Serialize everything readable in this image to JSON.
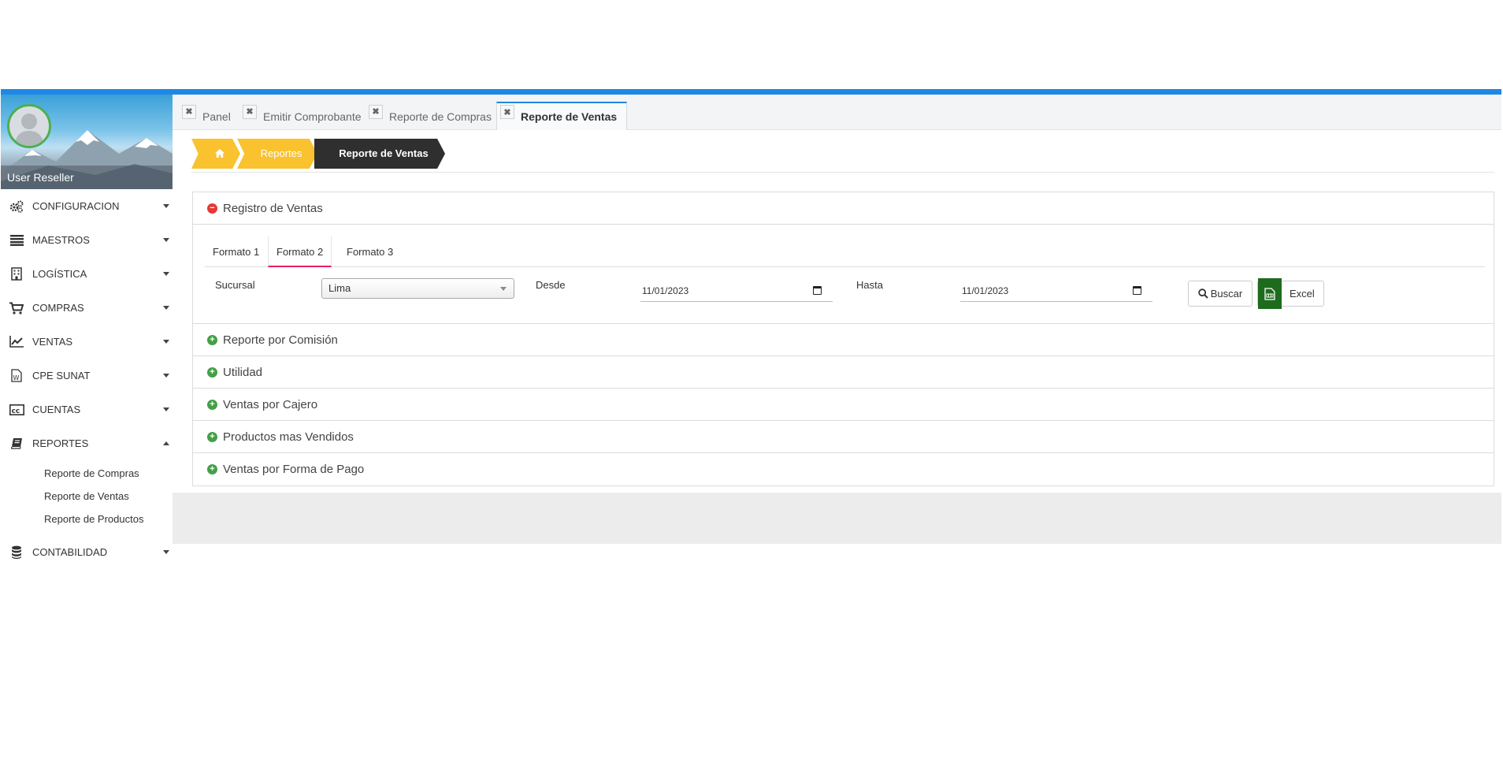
{
  "sidebar": {
    "username": "User Reseller",
    "menu": [
      {
        "label": "CONFIGURACION",
        "icon": "gears-icon"
      },
      {
        "label": "MAESTROS",
        "icon": "bars-icon"
      },
      {
        "label": "LOGÍSTICA",
        "icon": "building-icon"
      },
      {
        "label": "COMPRAS",
        "icon": "cart-icon"
      },
      {
        "label": "VENTAS",
        "icon": "line-chart-icon"
      },
      {
        "label": "CPE SUNAT",
        "icon": "word-file-icon"
      },
      {
        "label": "CUENTAS",
        "icon": "cc-icon"
      },
      {
        "label": "REPORTES",
        "icon": "book-icon"
      },
      {
        "label": "CONTABILIDAD",
        "icon": "database-icon"
      }
    ],
    "submenu": [
      "Reporte de Compras",
      "Reporte de Ventas",
      "Reporte de Productos"
    ]
  },
  "tabs": [
    {
      "label": "Panel"
    },
    {
      "label": "Emitir Comprobante"
    },
    {
      "label": "Reporte de Compras"
    },
    {
      "label": "Reporte de Ventas"
    }
  ],
  "breadcrumb": {
    "section": "Reportes",
    "current": "Reporte de Ventas"
  },
  "accordion": {
    "open": "Registro de Ventas",
    "sections": [
      "Reporte por Comisión",
      "Utilidad",
      "Ventas por Cajero",
      "Productos mas Vendidos",
      "Ventas por Forma de Pago"
    ]
  },
  "formats": [
    "Formato 1",
    "Formato 2",
    "Formato 3"
  ],
  "filters": {
    "sucursal_label": "Sucursal",
    "sucursal_value": "Lima",
    "desde_label": "Desde",
    "desde_value": "11/01/2023",
    "hasta_label": "Hasta",
    "hasta_value": "11/01/2023"
  },
  "buttons": {
    "buscar": "Buscar",
    "excel": "Excel"
  },
  "colors": {
    "accent": "#1e88e5",
    "breadcrumb": "#f9c22e",
    "active_tab_underline": "#e91e63",
    "excel": "#1e6b1e"
  }
}
